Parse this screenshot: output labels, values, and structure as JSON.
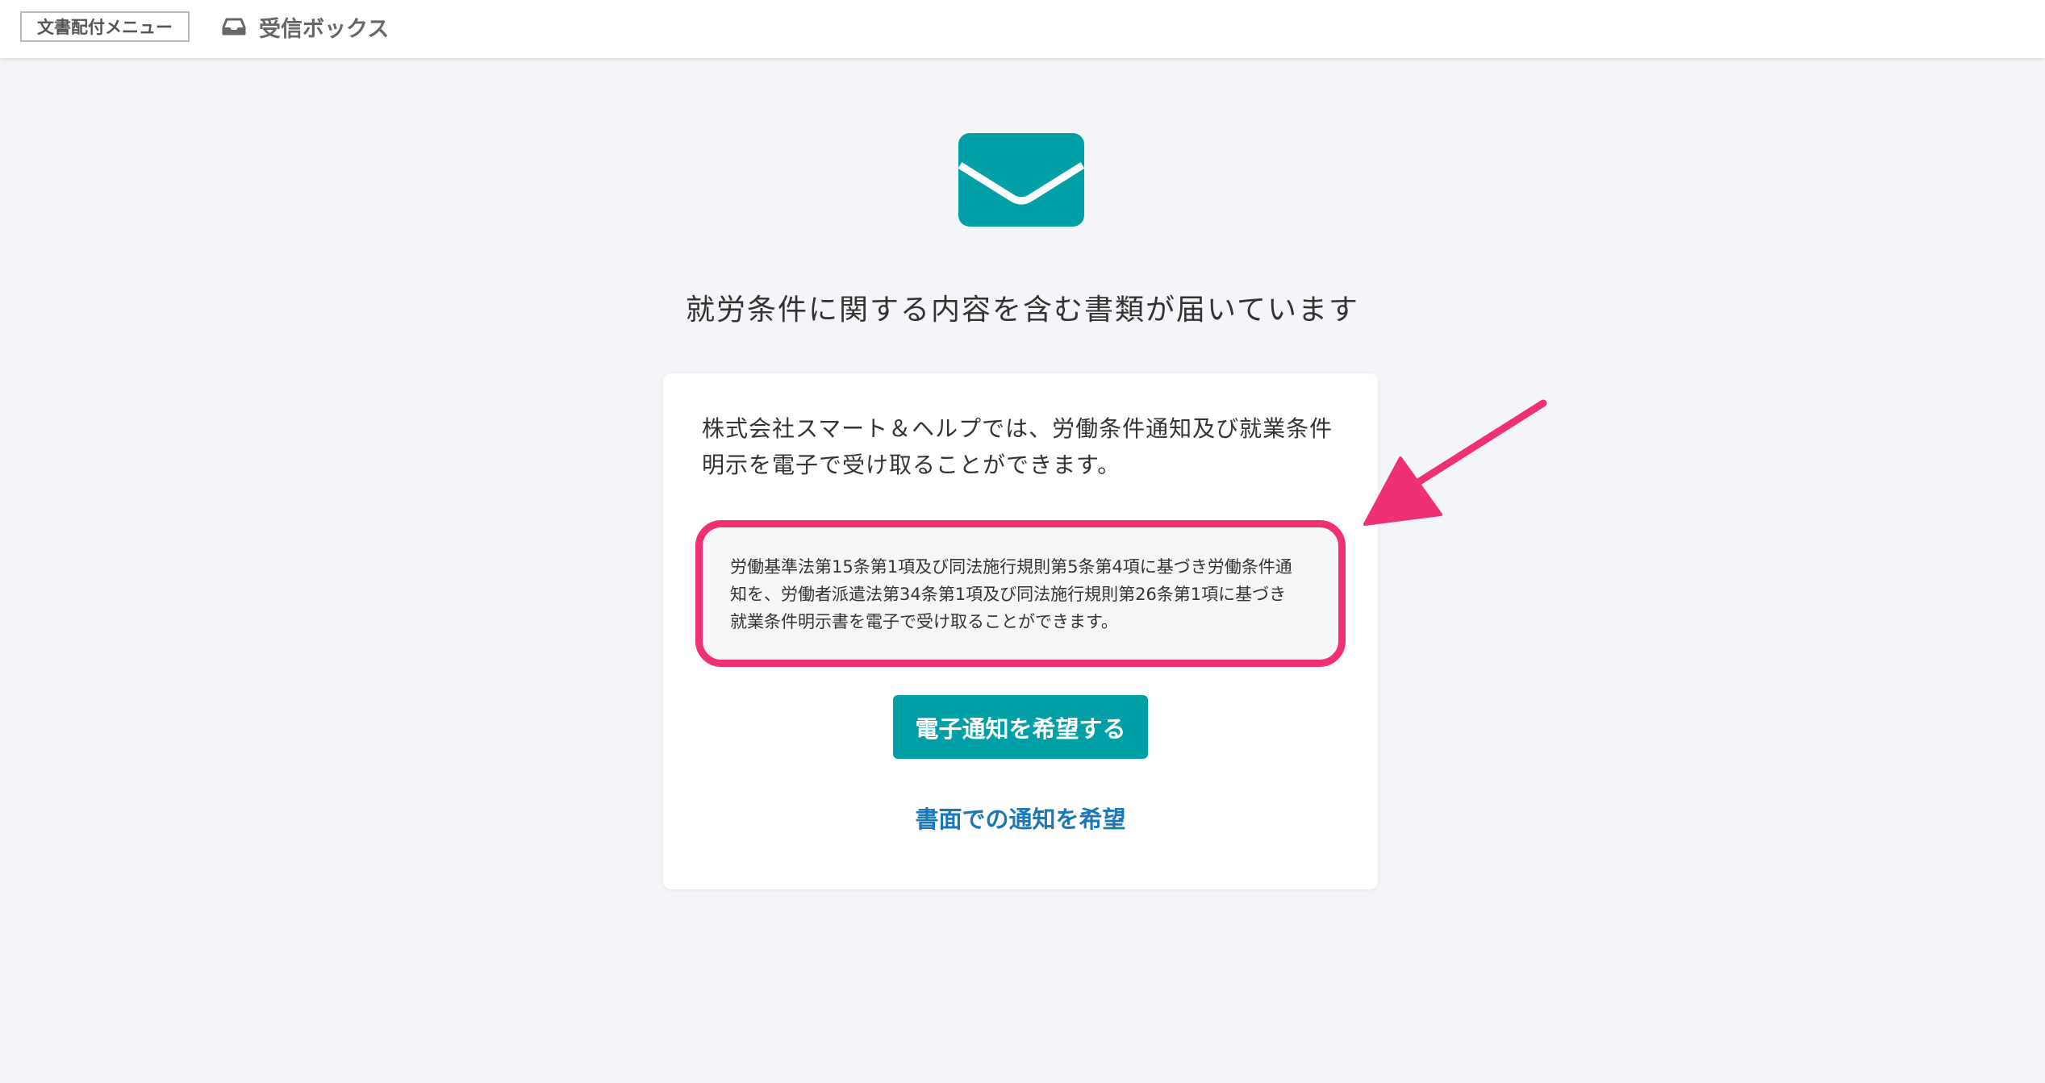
{
  "header": {
    "menu_label": "文書配付メニュー",
    "inbox_label": "受信ボックス",
    "inbox_icon": "inbox-icon"
  },
  "main": {
    "icon": "envelope-icon",
    "headline": "就労条件に関する内容を含む書類が届いています",
    "card": {
      "intro": "株式会社スマート＆ヘルプでは、労働条件通知及び就業条件明示を電子で受け取ることができます。",
      "legal_lines": [
        "労働基準法第15条第1項及び同法施行規則第5条第4項に基づき労働条件通",
        "知を、労働者派遣法第34条第1項及び同法施行規則第26条第1項に基づき",
        "就業条件明示書を電子で受け取ることができます。"
      ],
      "primary_button": "電子通知を希望する",
      "secondary_link": "書面での通知を希望"
    }
  },
  "colors": {
    "accent": "#00a0a6",
    "link": "#1a78b4",
    "highlight": "#f03075",
    "background": "#f4f5f8"
  }
}
